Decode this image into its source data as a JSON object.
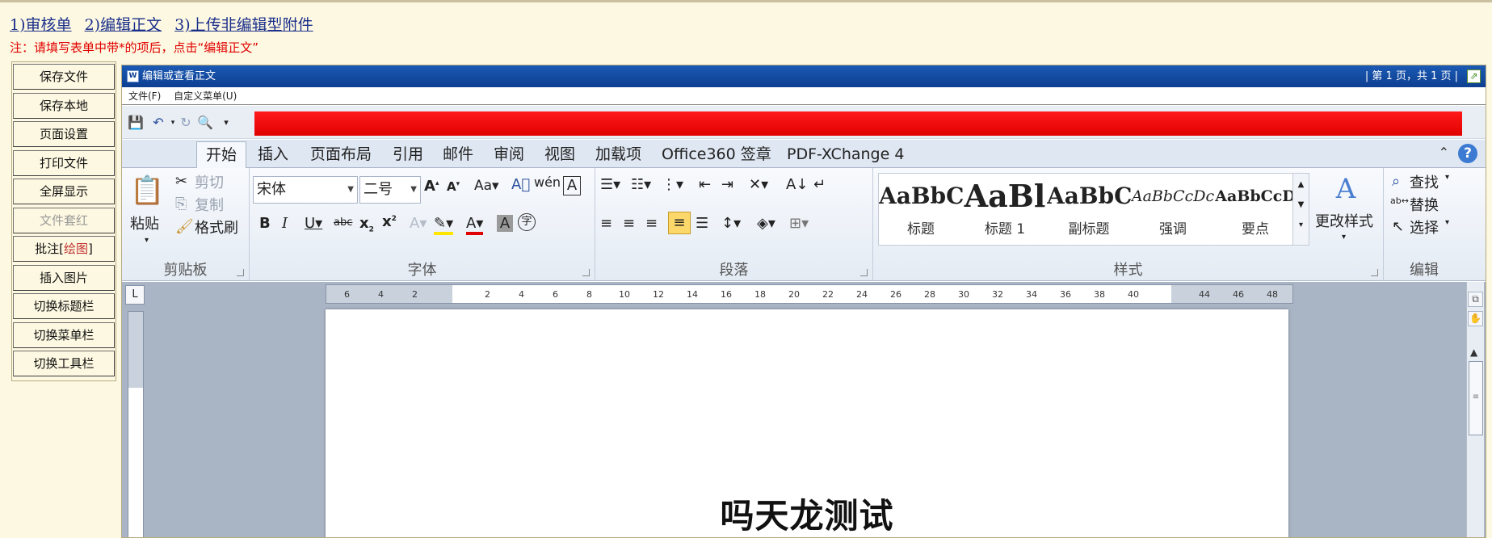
{
  "steps": [
    "1)审核单",
    "2)编辑正文",
    "3)上传非编辑型附件"
  ],
  "note": "注：请填写表单中带*的项后，点击“编辑正文”",
  "left_nav": {
    "items": [
      {
        "label": "保存文件"
      },
      {
        "label": "保存本地"
      },
      {
        "label": "页面设置"
      },
      {
        "label": "打印文件"
      },
      {
        "label": "全屏显示"
      },
      {
        "label": "文件套红",
        "disabled": true
      },
      {
        "label_prefix": "批注[",
        "label_highlight": "绘图",
        "label_suffix": "]"
      },
      {
        "label": "插入图片"
      },
      {
        "label": "切换标题栏"
      },
      {
        "label": "切换菜单栏"
      },
      {
        "label": "切换工具栏"
      }
    ]
  },
  "editor": {
    "window_title": "编辑或查看正文",
    "page_indicator": "| 第 1 页，共 1 页 |",
    "menu": [
      "文件(F)",
      "自定义菜单(U)"
    ],
    "tabs": [
      "开始",
      "插入",
      "页面布局",
      "引用",
      "邮件",
      "审阅",
      "视图",
      "加载项",
      "Office360 签章",
      "PDF-XChange 4"
    ],
    "active_tab": "开始",
    "clipboard": {
      "group": "剪贴板",
      "paste": "粘贴",
      "cut": "剪切",
      "copy": "复制",
      "format_painter": "格式刷"
    },
    "font": {
      "group": "字体",
      "font_name": "宋体",
      "font_size": "二号"
    },
    "paragraph": {
      "group": "段落"
    },
    "styles": {
      "group": "样式",
      "items": [
        {
          "sample": "AaBbC",
          "name": "标题"
        },
        {
          "sample": "AaBl",
          "name": "标题 1"
        },
        {
          "sample": "AaBbC",
          "name": "副标题"
        },
        {
          "sample": "AaBbCcDc",
          "name": "强调"
        },
        {
          "sample": "AaBbCcD",
          "name": "要点"
        }
      ],
      "change_styles": "更改样式"
    },
    "editing": {
      "group": "编辑",
      "find": "查找",
      "replace": "替换",
      "select": "选择"
    },
    "ruler_ticks": [
      "6",
      "4",
      "2",
      "2",
      "4",
      "6",
      "8",
      "10",
      "12",
      "14",
      "16",
      "18",
      "20",
      "22",
      "24",
      "26",
      "28",
      "30",
      "32",
      "34",
      "36",
      "38",
      "40",
      "44",
      "46",
      "48"
    ],
    "document": {
      "title": "吗天龙测试"
    }
  },
  "colors": {
    "step_link": "#1a2f8a",
    "note": "#e00000",
    "titlebar": "#1b5ab4",
    "red_bar": "#e10000",
    "background": "#fdf8e1"
  }
}
